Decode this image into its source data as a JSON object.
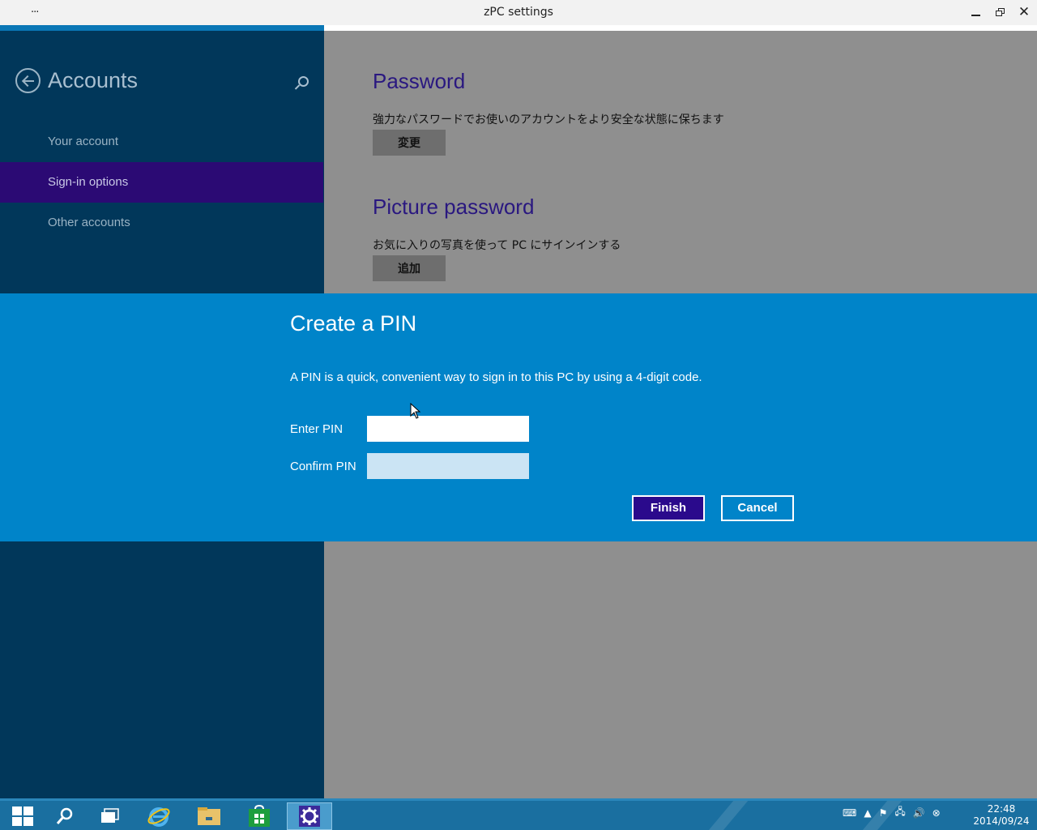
{
  "window": {
    "menu": "...",
    "title": "zPC settings",
    "minimize_glyph": "—",
    "close_glyph": "✕"
  },
  "sidebar": {
    "title": "Accounts",
    "items": [
      {
        "label": "Your account",
        "selected": false
      },
      {
        "label": "Sign-in options",
        "selected": true
      },
      {
        "label": "Other accounts",
        "selected": false
      }
    ]
  },
  "sections": {
    "password": {
      "title": "Password",
      "description": "強力なパスワードでお使いのアカウントをより安全な状態に保ちます",
      "button": "変更"
    },
    "picture_password": {
      "title": "Picture password",
      "description": "お気に入りの写真を使って PC にサインインする",
      "button": "追加"
    }
  },
  "dialog": {
    "title": "Create a PIN",
    "description": "A PIN is a quick, convenient way to sign in to this PC by using a 4-digit code.",
    "enter_label": "Enter PIN",
    "enter_value": "",
    "confirm_label": "Confirm PIN",
    "confirm_value": "",
    "finish": "Finish",
    "cancel": "Cancel"
  },
  "taskbar": {
    "icons": [
      "windows-start-icon",
      "search-icon",
      "task-view-icon",
      "internet-explorer-icon",
      "file-explorer-icon",
      "store-icon",
      "settings-gear-icon"
    ],
    "clock_time": "22:48",
    "clock_date": "2014/09/24"
  },
  "colors": {
    "sidebar_bg": "#01375a",
    "selected_item": "#2b0a74",
    "dialog_bg": "#0084c9",
    "finish_button": "#2a0a8c",
    "content_bg": "#8f8f8f"
  }
}
